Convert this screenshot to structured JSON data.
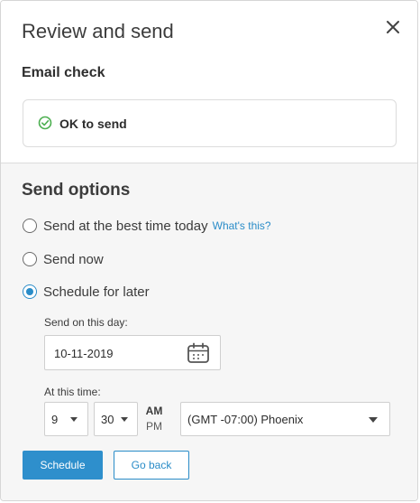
{
  "dialog": {
    "title": "Review and send",
    "close_icon": "close-icon"
  },
  "email_check": {
    "heading": "Email check",
    "status_text": "OK to send",
    "status_icon": "check-circle-icon",
    "status_color": "#4caf50"
  },
  "send_options": {
    "heading": "Send options",
    "options": [
      {
        "label": "Send at the best time today",
        "link": "What's this?",
        "selected": false
      },
      {
        "label": "Send now",
        "selected": false
      },
      {
        "label": "Schedule for later",
        "selected": true
      }
    ],
    "date_label": "Send on this day:",
    "date_value": "10-11-2019",
    "date_icon": "calendar-icon",
    "time_label": "At this time:",
    "hour": "9",
    "minute": "30",
    "am_label": "AM",
    "pm_label": "PM",
    "timezone": "(GMT -07:00) Phoenix"
  },
  "actions": {
    "schedule_label": "Schedule",
    "back_label": "Go back"
  },
  "colors": {
    "accent": "#2a8cc8",
    "primary_button": "#2e8fcc",
    "section_background": "#f6f6f6"
  }
}
